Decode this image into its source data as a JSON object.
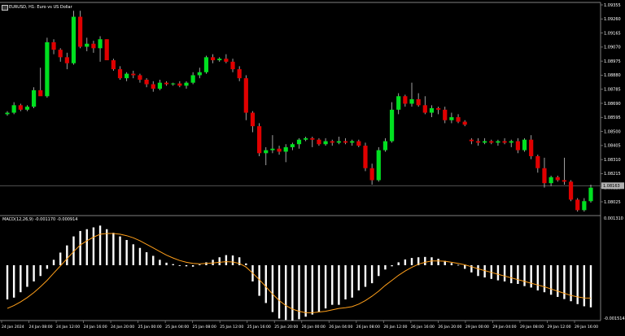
{
  "header": {
    "symbol_title": "EURUSD, H1:  Euro vs US Dollar",
    "macd_title": "MACD(12,26,9) -0.001170 -0.000914"
  },
  "colors": {
    "bull": "#00e020",
    "bear": "#e00000",
    "wick": "#c8c8c8",
    "macd_hist": "#ffffff",
    "signal": "#ff9f1a",
    "price_line": "#707070",
    "background": "#000000"
  },
  "price_axis": {
    "labels": [
      "1.09355",
      "1.09260",
      "1.09165",
      "1.09070",
      "1.08975",
      "1.08880",
      "1.08785",
      "1.08690",
      "1.08595",
      "1.08500",
      "1.08405",
      "1.08310",
      "1.08215",
      "1.08120",
      "1.08025"
    ],
    "current_price": "1.08163"
  },
  "macd_axis": {
    "top_label": "0.001310",
    "bottom_label": "-0.001514"
  },
  "time_axis": {
    "labels": [
      "24 Jan 2024",
      "24 Jan 08:00",
      "24 Jan 12:00",
      "24 Jan 16:00",
      "24 Jan 20:00",
      "25 Jan 00:00",
      "25 Jan 04:00",
      "25 Jan 08:00",
      "25 Jan 12:00",
      "25 Jan 16:00",
      "25 Jan 20:00",
      "26 Jan 00:00",
      "26 Jan 04:00",
      "26 Jan 08:00",
      "26 Jan 12:00",
      "26 Jan 16:00",
      "26 Jan 20:00",
      "29 Jan 00:00",
      "29 Jan 04:00",
      "29 Jan 08:00",
      "29 Jan 12:00",
      "29 Jan 16:00"
    ]
  },
  "chart_data": [
    {
      "type": "candlestick",
      "title": "EURUSD, H1:  Euro vs US Dollar",
      "ylim": [
        1.0798,
        1.0938
      ],
      "candles": [
        {
          "o": 1.0864,
          "h": 1.0866,
          "l": 1.0863,
          "c": 1.0865
        },
        {
          "o": 1.0865,
          "h": 1.0872,
          "l": 1.0864,
          "c": 1.087
        },
        {
          "o": 1.087,
          "h": 1.0871,
          "l": 1.0866,
          "c": 1.0867
        },
        {
          "o": 1.0867,
          "h": 1.087,
          "l": 1.0866,
          "c": 1.0869
        },
        {
          "o": 1.0869,
          "h": 1.0882,
          "l": 1.0868,
          "c": 1.088
        },
        {
          "o": 1.088,
          "h": 1.0895,
          "l": 1.0877,
          "c": 1.0876
        },
        {
          "o": 1.0876,
          "h": 1.0915,
          "l": 1.0875,
          "c": 1.0912
        },
        {
          "o": 1.0912,
          "h": 1.0914,
          "l": 1.0904,
          "c": 1.0907
        },
        {
          "o": 1.0907,
          "h": 1.0908,
          "l": 1.0899,
          "c": 1.0902
        },
        {
          "o": 1.0902,
          "h": 1.0905,
          "l": 1.0894,
          "c": 1.0898
        },
        {
          "o": 1.0898,
          "h": 1.0933,
          "l": 1.0897,
          "c": 1.0929
        },
        {
          "o": 1.0929,
          "h": 1.0933,
          "l": 1.0908,
          "c": 1.0909
        },
        {
          "o": 1.0909,
          "h": 1.0915,
          "l": 1.0906,
          "c": 1.0911
        },
        {
          "o": 1.0911,
          "h": 1.0913,
          "l": 1.0905,
          "c": 1.0908
        },
        {
          "o": 1.0908,
          "h": 1.0916,
          "l": 1.0899,
          "c": 1.0914
        },
        {
          "o": 1.0914,
          "h": 1.0914,
          "l": 1.09,
          "c": 1.09
        },
        {
          "o": 1.09,
          "h": 1.0901,
          "l": 1.0893,
          "c": 1.0894
        },
        {
          "o": 1.0894,
          "h": 1.0896,
          "l": 1.0887,
          "c": 1.0888
        },
        {
          "o": 1.0888,
          "h": 1.0892,
          "l": 1.0886,
          "c": 1.0891
        },
        {
          "o": 1.0891,
          "h": 1.0893,
          "l": 1.0888,
          "c": 1.089
        },
        {
          "o": 1.089,
          "h": 1.0891,
          "l": 1.0885,
          "c": 1.0887
        },
        {
          "o": 1.0887,
          "h": 1.0888,
          "l": 1.0882,
          "c": 1.0884
        },
        {
          "o": 1.0884,
          "h": 1.0886,
          "l": 1.0879,
          "c": 1.0881
        },
        {
          "o": 1.0881,
          "h": 1.0887,
          "l": 1.088,
          "c": 1.0885
        },
        {
          "o": 1.0885,
          "h": 1.0886,
          "l": 1.0883,
          "c": 1.0884
        },
        {
          "o": 1.0884,
          "h": 1.0885,
          "l": 1.0883,
          "c": 1.08845
        },
        {
          "o": 1.08845,
          "h": 1.0886,
          "l": 1.0882,
          "c": 1.0883
        },
        {
          "o": 1.0883,
          "h": 1.0886,
          "l": 1.0881,
          "c": 1.0885
        },
        {
          "o": 1.0885,
          "h": 1.0892,
          "l": 1.0884,
          "c": 1.089
        },
        {
          "o": 1.089,
          "h": 1.0895,
          "l": 1.0888,
          "c": 1.0892
        },
        {
          "o": 1.0892,
          "h": 1.0903,
          "l": 1.0891,
          "c": 1.0902
        },
        {
          "o": 1.0902,
          "h": 1.0904,
          "l": 1.0898,
          "c": 1.09
        },
        {
          "o": 1.09,
          "h": 1.0902,
          "l": 1.0899,
          "c": 1.0901
        },
        {
          "o": 1.0901,
          "h": 1.0904,
          "l": 1.0898,
          "c": 1.0899
        },
        {
          "o": 1.0899,
          "h": 1.0901,
          "l": 1.0892,
          "c": 1.0894
        },
        {
          "o": 1.0894,
          "h": 1.0896,
          "l": 1.0886,
          "c": 1.0888
        },
        {
          "o": 1.0888,
          "h": 1.089,
          "l": 1.086,
          "c": 1.0865
        },
        {
          "o": 1.0865,
          "h": 1.0866,
          "l": 1.0852,
          "c": 1.0856
        },
        {
          "o": 1.0856,
          "h": 1.0858,
          "l": 1.0836,
          "c": 1.0838
        },
        {
          "o": 1.0838,
          "h": 1.0842,
          "l": 1.083,
          "c": 1.084
        },
        {
          "o": 1.084,
          "h": 1.085,
          "l": 1.0838,
          "c": 1.0841
        },
        {
          "o": 1.0841,
          "h": 1.0843,
          "l": 1.0837,
          "c": 1.0839
        },
        {
          "o": 1.0839,
          "h": 1.0844,
          "l": 1.0832,
          "c": 1.0842
        },
        {
          "o": 1.0842,
          "h": 1.0845,
          "l": 1.084,
          "c": 1.0844
        },
        {
          "o": 1.0844,
          "h": 1.0848,
          "l": 1.0841,
          "c": 1.0847
        },
        {
          "o": 1.0847,
          "h": 1.0849,
          "l": 1.0846,
          "c": 1.0848
        },
        {
          "o": 1.0848,
          "h": 1.0849,
          "l": 1.0842,
          "c": 1.0847
        },
        {
          "o": 1.0847,
          "h": 1.0848,
          "l": 1.0843,
          "c": 1.0844
        },
        {
          "o": 1.0844,
          "h": 1.0848,
          "l": 1.0843,
          "c": 1.0846
        },
        {
          "o": 1.0846,
          "h": 1.0847,
          "l": 1.0843,
          "c": 1.0845
        },
        {
          "o": 1.0845,
          "h": 1.0849,
          "l": 1.0844,
          "c": 1.0846
        },
        {
          "o": 1.0846,
          "h": 1.0848,
          "l": 1.0844,
          "c": 1.0845
        },
        {
          "o": 1.0845,
          "h": 1.0847,
          "l": 1.0843,
          "c": 1.0846
        },
        {
          "o": 1.0846,
          "h": 1.0847,
          "l": 1.0842,
          "c": 1.0843
        },
        {
          "o": 1.0843,
          "h": 1.0845,
          "l": 1.0826,
          "c": 1.0828
        },
        {
          "o": 1.0828,
          "h": 1.0831,
          "l": 1.0817,
          "c": 1.082
        },
        {
          "o": 1.082,
          "h": 1.0842,
          "l": 1.0819,
          "c": 1.084
        },
        {
          "o": 1.084,
          "h": 1.0848,
          "l": 1.0839,
          "c": 1.0846
        },
        {
          "o": 1.0846,
          "h": 1.0872,
          "l": 1.0845,
          "c": 1.0867
        },
        {
          "o": 1.0867,
          "h": 1.0878,
          "l": 1.0864,
          "c": 1.0876
        },
        {
          "o": 1.0876,
          "h": 1.0877,
          "l": 1.0869,
          "c": 1.0871
        },
        {
          "o": 1.0871,
          "h": 1.0885,
          "l": 1.0869,
          "c": 1.0874
        },
        {
          "o": 1.0874,
          "h": 1.0878,
          "l": 1.0869,
          "c": 1.087
        },
        {
          "o": 1.087,
          "h": 1.0876,
          "l": 1.0864,
          "c": 1.0865
        },
        {
          "o": 1.0865,
          "h": 1.087,
          "l": 1.0862,
          "c": 1.0868
        },
        {
          "o": 1.0868,
          "h": 1.0869,
          "l": 1.0864,
          "c": 1.0867
        },
        {
          "o": 1.0867,
          "h": 1.0869,
          "l": 1.0858,
          "c": 1.086
        },
        {
          "o": 1.086,
          "h": 1.0865,
          "l": 1.0858,
          "c": 1.0862
        },
        {
          "o": 1.0862,
          "h": 1.0864,
          "l": 1.0858,
          "c": 1.0859
        },
        {
          "o": 1.0859,
          "h": 1.086,
          "l": 1.0856,
          "c": 1.0857
        },
        {
          "o": 1.0847,
          "h": 1.0848,
          "l": 1.0844,
          "c": 1.0846
        },
        {
          "o": 1.0846,
          "h": 1.0848,
          "l": 1.0843,
          "c": 1.0845
        },
        {
          "o": 1.0845,
          "h": 1.0848,
          "l": 1.0844,
          "c": 1.0846
        },
        {
          "o": 1.0846,
          "h": 1.0847,
          "l": 1.0844,
          "c": 1.0845
        },
        {
          "o": 1.0845,
          "h": 1.0847,
          "l": 1.0843,
          "c": 1.0846
        },
        {
          "o": 1.0846,
          "h": 1.0848,
          "l": 1.0844,
          "c": 1.0845
        },
        {
          "o": 1.0845,
          "h": 1.0847,
          "l": 1.0842,
          "c": 1.0846
        },
        {
          "o": 1.0846,
          "h": 1.0848,
          "l": 1.0838,
          "c": 1.084
        },
        {
          "o": 1.084,
          "h": 1.0848,
          "l": 1.0839,
          "c": 1.0847
        },
        {
          "o": 1.0847,
          "h": 1.085,
          "l": 1.0834,
          "c": 1.0836
        },
        {
          "o": 1.0836,
          "h": 1.0837,
          "l": 1.0825,
          "c": 1.0828
        },
        {
          "o": 1.0828,
          "h": 1.0835,
          "l": 1.0815,
          "c": 1.0818
        },
        {
          "o": 1.0818,
          "h": 1.0823,
          "l": 1.0816,
          "c": 1.0822
        },
        {
          "o": 1.0822,
          "h": 1.0823,
          "l": 1.0819,
          "c": 1.082
        },
        {
          "o": 1.082,
          "h": 1.0835,
          "l": 1.0817,
          "c": 1.0819
        },
        {
          "o": 1.0819,
          "h": 1.082,
          "l": 1.0806,
          "c": 1.0807
        },
        {
          "o": 1.0807,
          "h": 1.0808,
          "l": 1.0799,
          "c": 1.08
        },
        {
          "o": 1.08,
          "h": 1.0808,
          "l": 1.0799,
          "c": 1.0806
        },
        {
          "o": 1.0806,
          "h": 1.0817,
          "l": 1.0805,
          "c": 1.0815
        }
      ]
    },
    {
      "type": "bar",
      "title": "MACD(12,26,9) -0.001170 -0.000914",
      "ylim": [
        -0.001514,
        0.00131
      ],
      "series": [
        {
          "values": [
            -0.00095,
            -0.0009,
            -0.00075,
            -0.0006,
            -0.00045,
            -0.0003,
            -0.0001,
            0.00015,
            0.00035,
            0.00055,
            0.0008,
            0.00095,
            0.001,
            0.00105,
            0.0011,
            0.001,
            0.0009,
            0.0008,
            0.0007,
            0.00058,
            0.00048,
            0.00036,
            0.00026,
            0.00015,
            7e-05,
            3e-05,
            -2e-05,
            -3e-05,
            -4e-05,
            2e-05,
            8e-05,
            0.00015,
            0.00022,
            0.00028,
            0.00027,
            0.00022,
            5e-05,
            -0.00045,
            -0.00085,
            -0.00105,
            -0.0013,
            -0.00148,
            -0.00152,
            -0.00154,
            -0.0015,
            -0.00143,
            -0.00137,
            -0.0013,
            -0.0012,
            -0.0011,
            -0.0011,
            -0.00095,
            -0.0009,
            -0.0007,
            -0.0006,
            -0.0005,
            -0.0003,
            -0.00012,
            -3e-05,
            8e-05,
            0.00016,
            0.0002,
            0.00022,
            0.00023,
            0.00022,
            0.00018,
            0.00012,
            6e-05,
            1e-05,
            -0.0001,
            -0.0002,
            -0.0003,
            -0.00034,
            -0.00038,
            -0.00042,
            -0.00045,
            -0.0005,
            -0.00052,
            -0.00058,
            -0.00062,
            -0.0007,
            -0.00075,
            -0.00082,
            -0.00088,
            -0.00094,
            -0.001,
            -0.00108,
            -0.00114,
            -0.00117
          ]
        },
        {
          "values": [
            -0.0012,
            -0.00112,
            -0.00102,
            -0.0009,
            -0.00076,
            -0.0006,
            -0.00042,
            -0.00022,
            -2e-05,
            0.00018,
            0.00038,
            0.00056,
            0.00068,
            0.00078,
            0.00086,
            0.00088,
            0.00088,
            0.00086,
            0.00082,
            0.00076,
            0.00068,
            0.00058,
            0.00048,
            0.00038,
            0.00028,
            0.0002,
            0.00013,
            8e-05,
            5e-05,
            4e-05,
            5e-05,
            6e-05,
            8e-05,
            0.0001,
            9e-05,
            5e-05,
            -5e-05,
            -0.00022,
            -0.0004,
            -0.0006,
            -0.0008,
            -0.00098,
            -0.00112,
            -0.00122,
            -0.00128,
            -0.00132,
            -0.00132,
            -0.0013,
            -0.00128,
            -0.00124,
            -0.0012,
            -0.00118,
            -0.00115,
            -0.00108,
            -0.00098,
            -0.00086,
            -0.00072,
            -0.00056,
            -0.00042,
            -0.00028,
            -0.00016,
            -6e-05,
            3e-05,
            8e-05,
            0.00012,
            0.00012,
            0.00011,
            8e-05,
            5e-05,
            1e-05,
            -4e-05,
            -0.0001,
            -0.00015,
            -0.0002,
            -0.00025,
            -0.0003,
            -0.00035,
            -0.0004,
            -0.00045,
            -0.0005,
            -0.00055,
            -0.0006,
            -0.00066,
            -0.00072,
            -0.00078,
            -0.00084,
            -0.00088,
            -0.00091,
            -0.000914
          ]
        }
      ]
    }
  ]
}
